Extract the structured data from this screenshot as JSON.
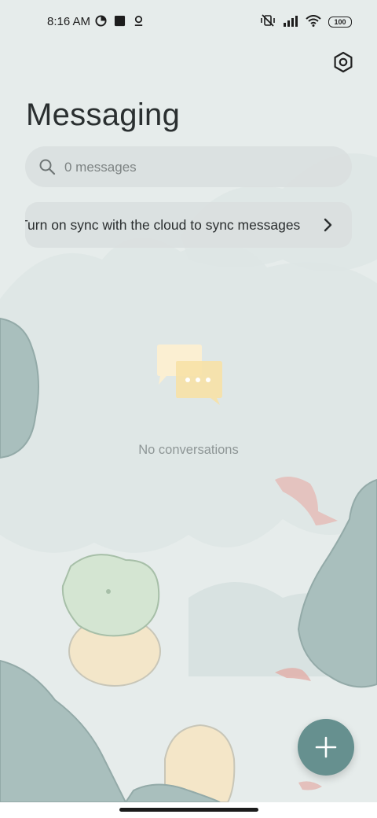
{
  "status_bar": {
    "time": "8:16 AM",
    "battery": "100",
    "icons": [
      "data-saver-icon",
      "square-notification-icon",
      "location-pin-icon",
      "vibrate-off-icon",
      "signal-icon",
      "wifi-icon",
      "battery-icon"
    ]
  },
  "header": {
    "title": "Messaging",
    "settings_icon": "settings-icon"
  },
  "search": {
    "placeholder": "0 messages",
    "icon": "search-icon"
  },
  "sync_banner": {
    "text": "Turn on sync with the cloud to sync messages",
    "icon": "chevron-right-icon"
  },
  "empty_state": {
    "icon": "chat-bubbles-icon",
    "text": "No conversations"
  },
  "fab": {
    "icon": "plus-icon"
  },
  "colors": {
    "background": "#e6eceb",
    "accent": "#66908f",
    "empty_icon_back": "#fbefd2",
    "empty_icon_front": "#f7e1a6"
  }
}
